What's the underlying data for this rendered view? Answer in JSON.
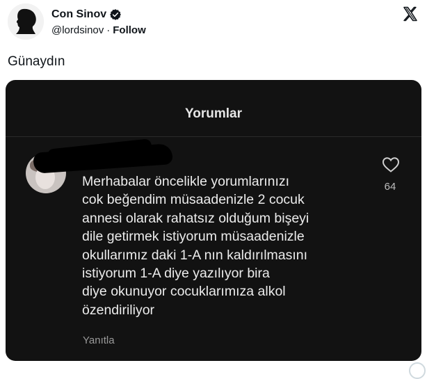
{
  "author": {
    "name": "Con Sinov",
    "handle": "@lordsinov",
    "separator": "·",
    "follow_label": "Follow"
  },
  "tweet": {
    "text": "Günaydın"
  },
  "media": {
    "title": "Yorumlar",
    "comment": {
      "text": "Merhabalar öncelikle yorumlarınızı\ncok beğendim müsaadenizle 2 cocuk\nannesi olarak rahatsız olduğum bişeyi\ndile getirmek istiyorum müsaadenizle\nokullarımız daki 1-A nın kaldırılmasını\nistiyorum 1-A diye yazılıyor bira\ndiye okunuyor cocuklarımıza alkol\nözendiriliyor",
      "reply_label": "Yanıtla",
      "like_count": "64"
    }
  },
  "icons": {
    "verified": "verified-badge-icon",
    "platform": "x-logo-icon",
    "like": "heart-outline-icon"
  },
  "colors": {
    "verified_blue": "#1d9bf0",
    "media_bg": "#121212"
  }
}
